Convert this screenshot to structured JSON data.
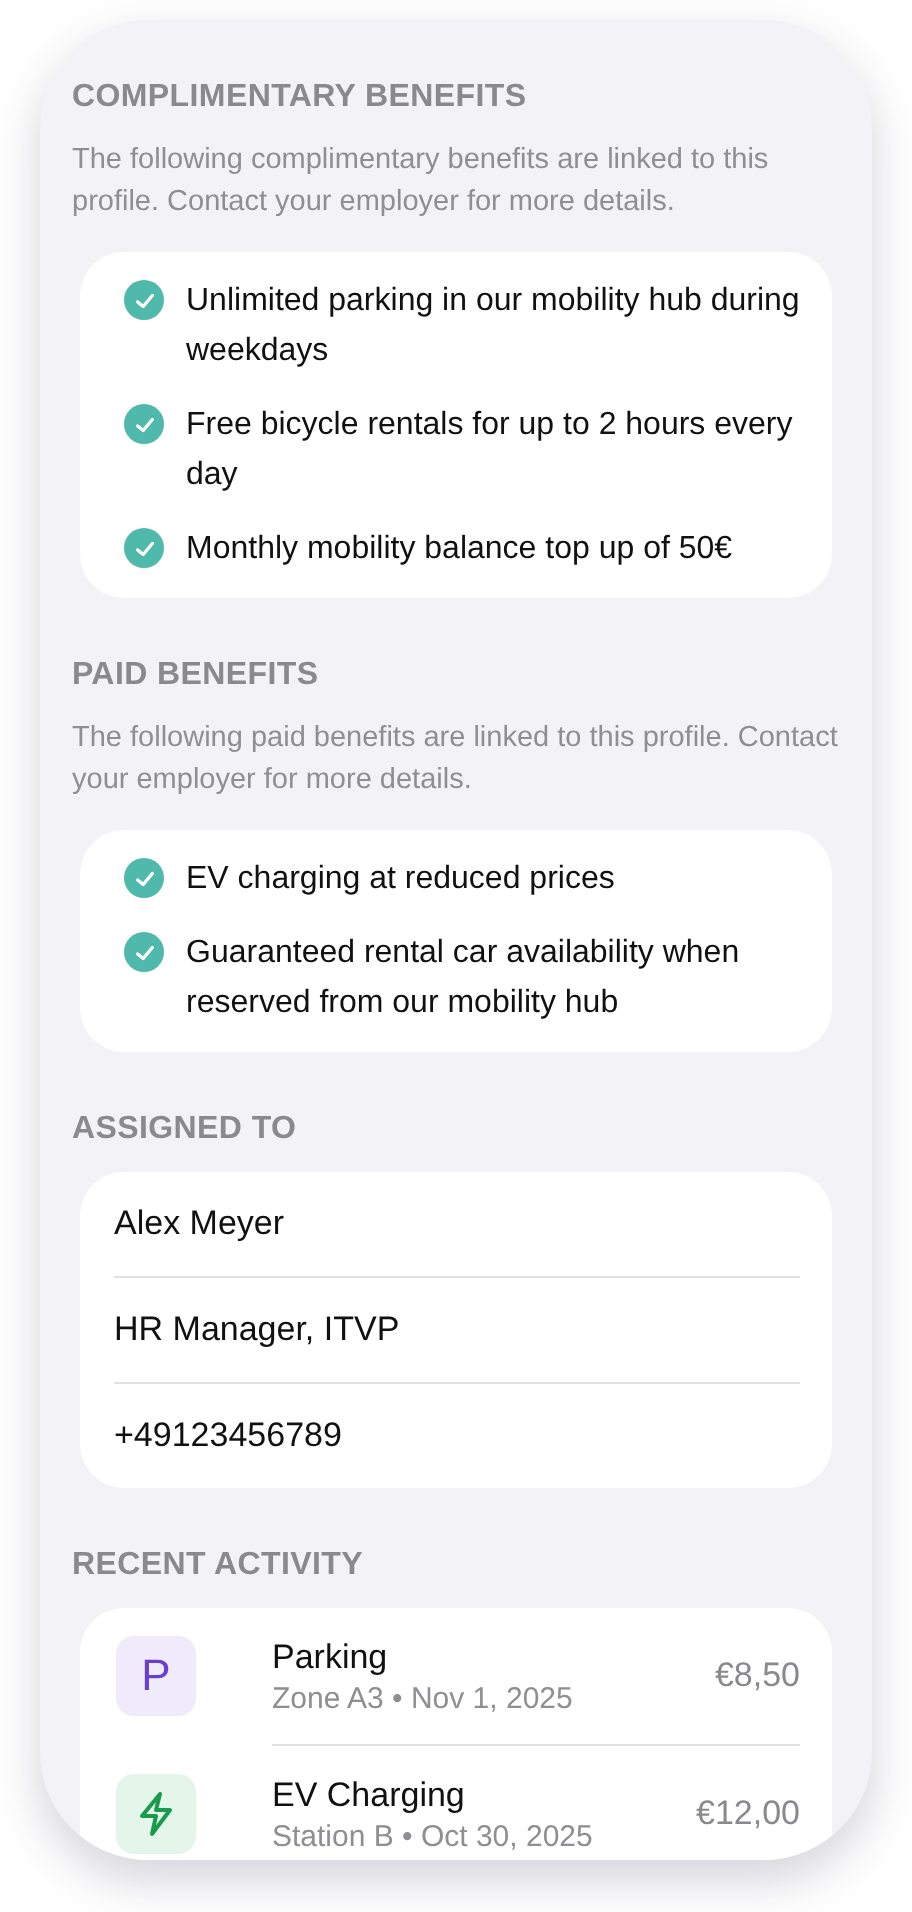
{
  "sections": [
    {
      "kind": "checklist",
      "title": "COMPLIMENTARY BENEFITS",
      "description": "The following complimentary benefits are linked to this profile. Contact your employer for more details.",
      "items": [
        {
          "label": "Unlimited parking in our mobility hub during weekdays",
          "checked": true
        },
        {
          "label": "Free bicycle rentals for up to 2 hours every day",
          "checked": true
        },
        {
          "label": "Monthly mobility balance top up of 50€",
          "checked": true
        }
      ]
    },
    {
      "kind": "checklist",
      "title": "PAID BENEFITS",
      "description": "The following paid benefits are linked to this profile. Contact your employer for more details.",
      "items": [
        {
          "label": "EV charging at reduced prices",
          "checked": true
        },
        {
          "label": "Guaranteed rental car availability when reserved from our mobility hub",
          "checked": true
        }
      ]
    },
    {
      "kind": "fields",
      "title": "ASSIGNED TO",
      "items": [
        {
          "label": "Alex Meyer"
        },
        {
          "label": "HR Manager, ITVP"
        },
        {
          "label": "+49123456789"
        }
      ]
    },
    {
      "kind": "activity",
      "title": "RECENT ACTIVITY",
      "items": [
        {
          "kind": "parking",
          "icon": "P",
          "title": "Parking",
          "subtitle": "Zone A3 • Nov 1, 2025",
          "amount": "€8,50"
        },
        {
          "kind": "charging",
          "title": "EV Charging",
          "subtitle": "Station B • Oct 30, 2025",
          "amount": "€12,00"
        }
      ]
    }
  ]
}
